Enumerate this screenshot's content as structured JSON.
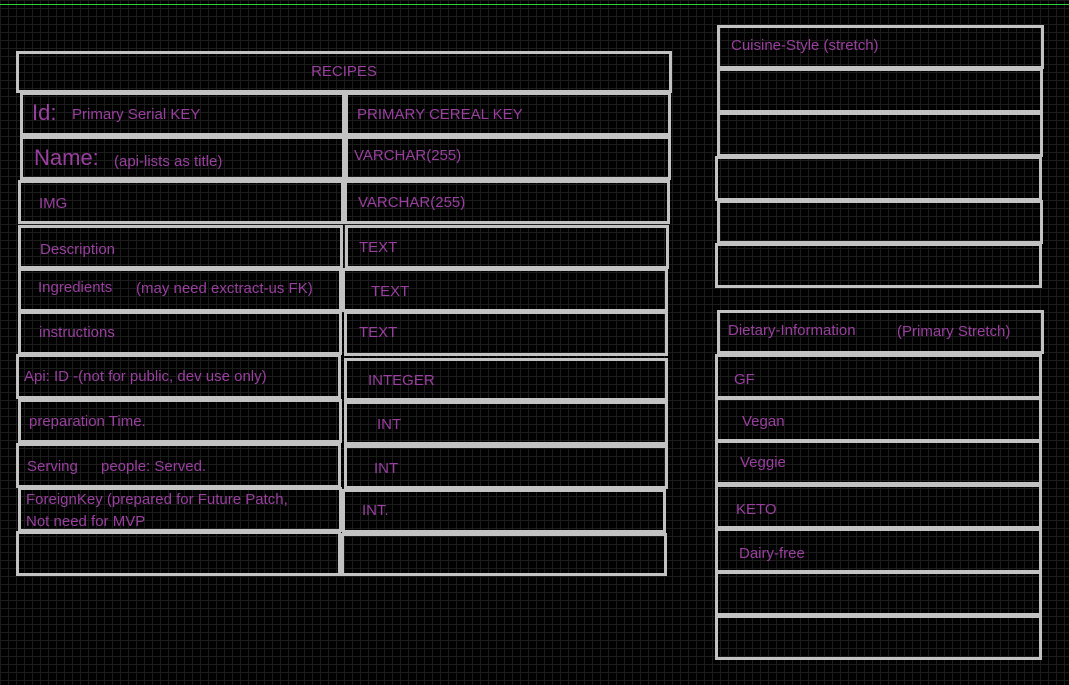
{
  "recipes": {
    "title": "RECIPES",
    "rows": [
      {
        "field": "Id:",
        "note": "Primary Serial KEY",
        "type": "PRIMARY CEREAL KEY"
      },
      {
        "field": "Name:",
        "note": "(api-lists as title)",
        "type": "VARCHAR(255)"
      },
      {
        "field": "IMG",
        "type": "VARCHAR(255)"
      },
      {
        "field": "Description",
        "type": "TEXT"
      },
      {
        "field": "Ingredients",
        "note": "(may need exctract-us FK)",
        "type": "TEXT"
      },
      {
        "field": "instructions",
        "type": "TEXT"
      },
      {
        "field": "Api: ID -(not for public, dev use only)",
        "type": "INTEGER"
      },
      {
        "field": "preparation Time.",
        "type": "INT"
      },
      {
        "field": "Serving",
        "note": "people: Served.",
        "type": "INT"
      },
      {
        "field": "ForeignKey (prepared for Future Patch,",
        "field_line2": "Not need for MVP",
        "type": "INT."
      }
    ]
  },
  "cuisine": {
    "title": "Cuisine-Style (stretch)"
  },
  "dietary": {
    "title": "Dietary-Information",
    "note": "(Primary Stretch)",
    "items": [
      "GF",
      "Vegan",
      "Veggie",
      "KETO",
      "Dairy-free"
    ]
  },
  "colors": {
    "background": "#000000",
    "text": "#9a3fa0",
    "border": "#c2c2c2",
    "top_line": "#2fd03a"
  }
}
